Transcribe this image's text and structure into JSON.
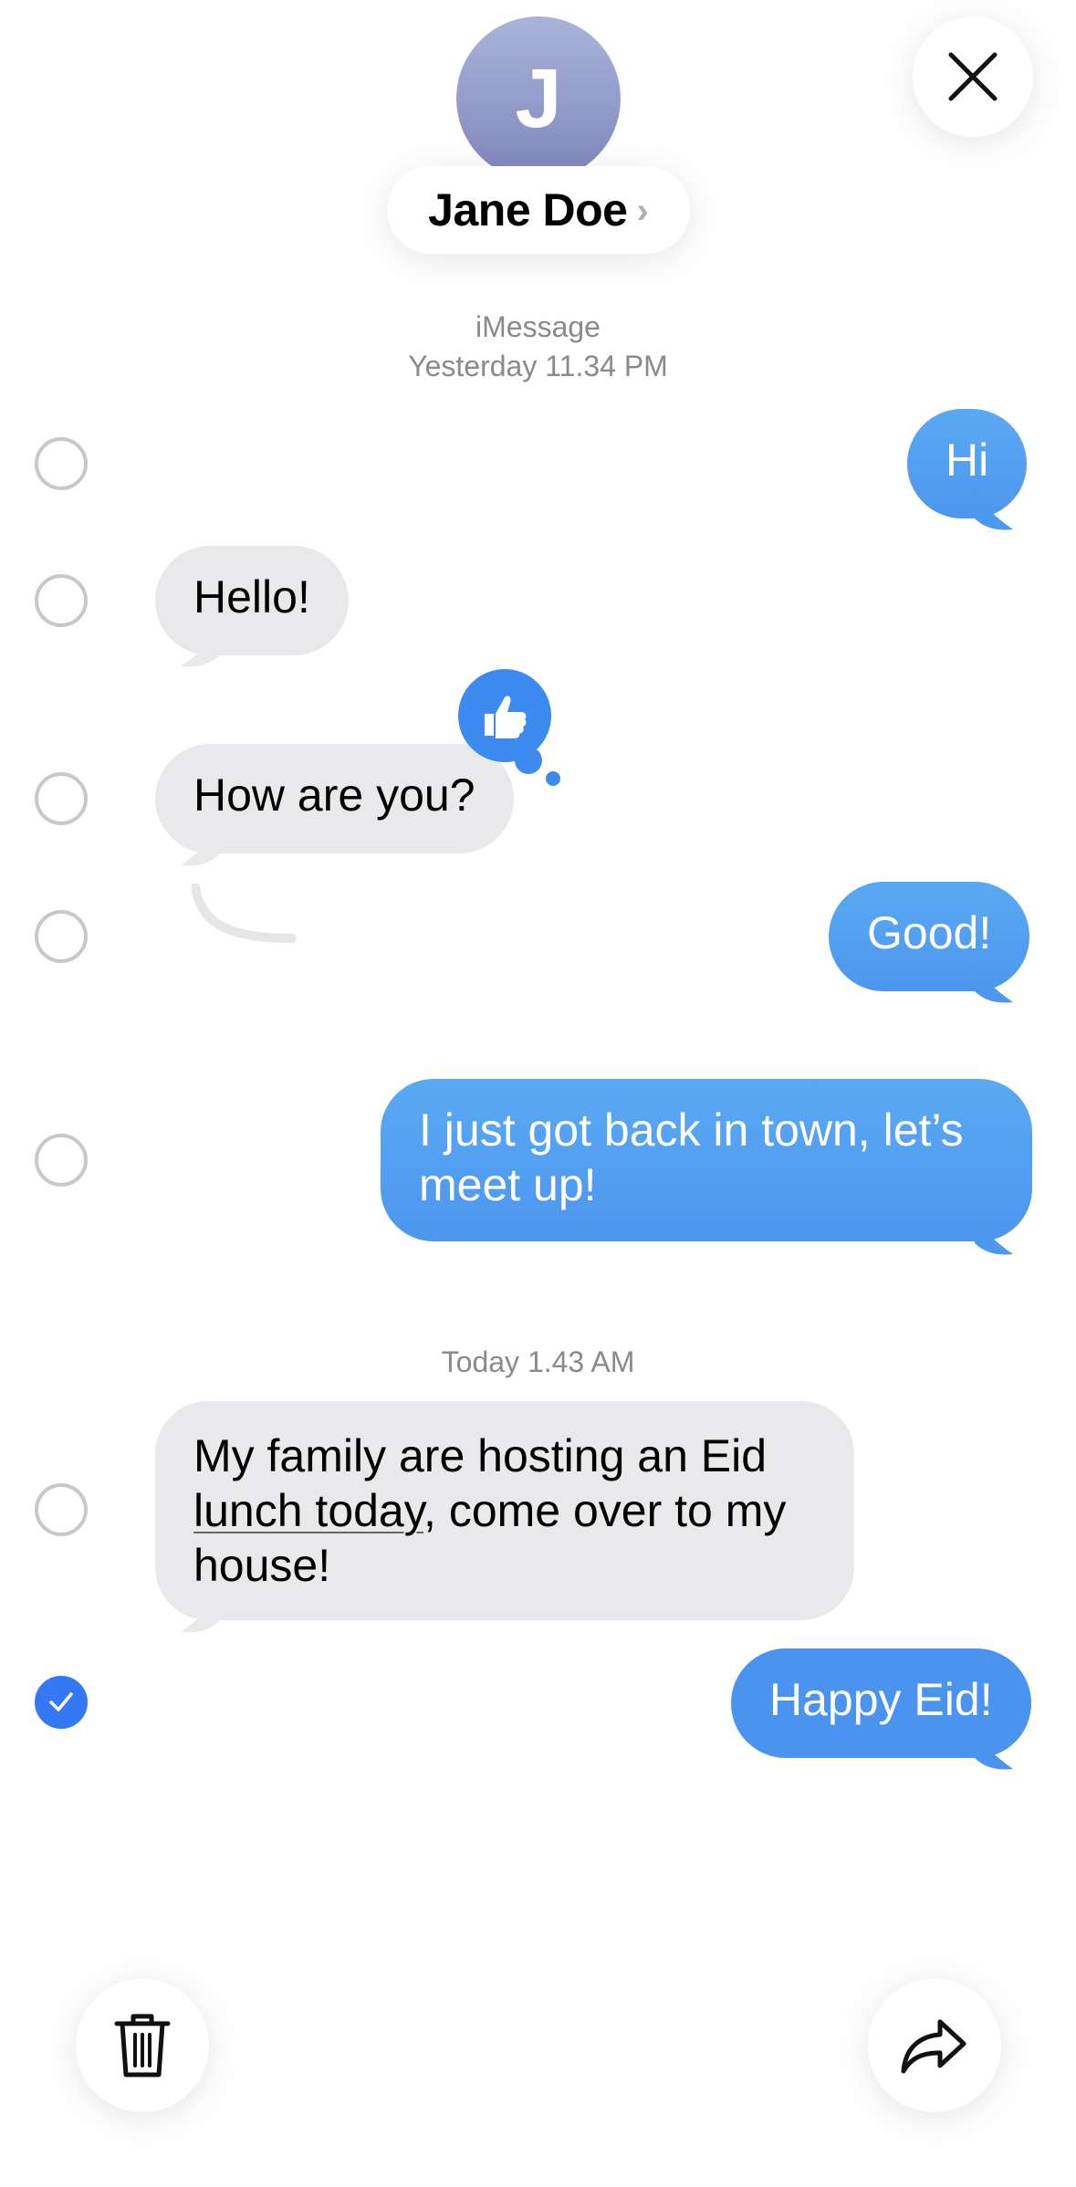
{
  "contact": {
    "initial": "J",
    "name": "Jane Doe",
    "chevron": "›"
  },
  "meta": {
    "service": "iMessage",
    "first_time": "Yesterday 11.34 PM",
    "second_time": "Today 1.43 AM"
  },
  "messages": [
    {
      "dir": "out",
      "text": "Hi",
      "selected": false
    },
    {
      "dir": "in",
      "text": "Hello!",
      "selected": false
    },
    {
      "dir": "in",
      "text": "How are you?",
      "selected": false,
      "tapback": "thumbs-up"
    },
    {
      "dir": "out",
      "text": "Good!",
      "selected": false
    },
    {
      "dir": "out",
      "text_line1": "I just got back in town, let’s",
      "text_line2": "meet up!",
      "selected": false
    },
    {
      "dir": "in",
      "text_line1": "My family are hosting an Eid",
      "text_line2_link": "lunch today",
      "text_line2_rest": ", come over to my",
      "text_line3": "house!",
      "selected": false
    },
    {
      "dir": "out",
      "text": "Happy Eid!",
      "selected": true
    }
  ],
  "icons": {
    "close": "close-icon",
    "delete": "trash-icon",
    "forward": "share-arrow-icon",
    "check": "checkmark-icon",
    "like": "thumbs-up-icon"
  },
  "colors": {
    "accent": "#3478f6",
    "incoming": "#e9e9eb",
    "outgoing": "#4d96ef"
  }
}
